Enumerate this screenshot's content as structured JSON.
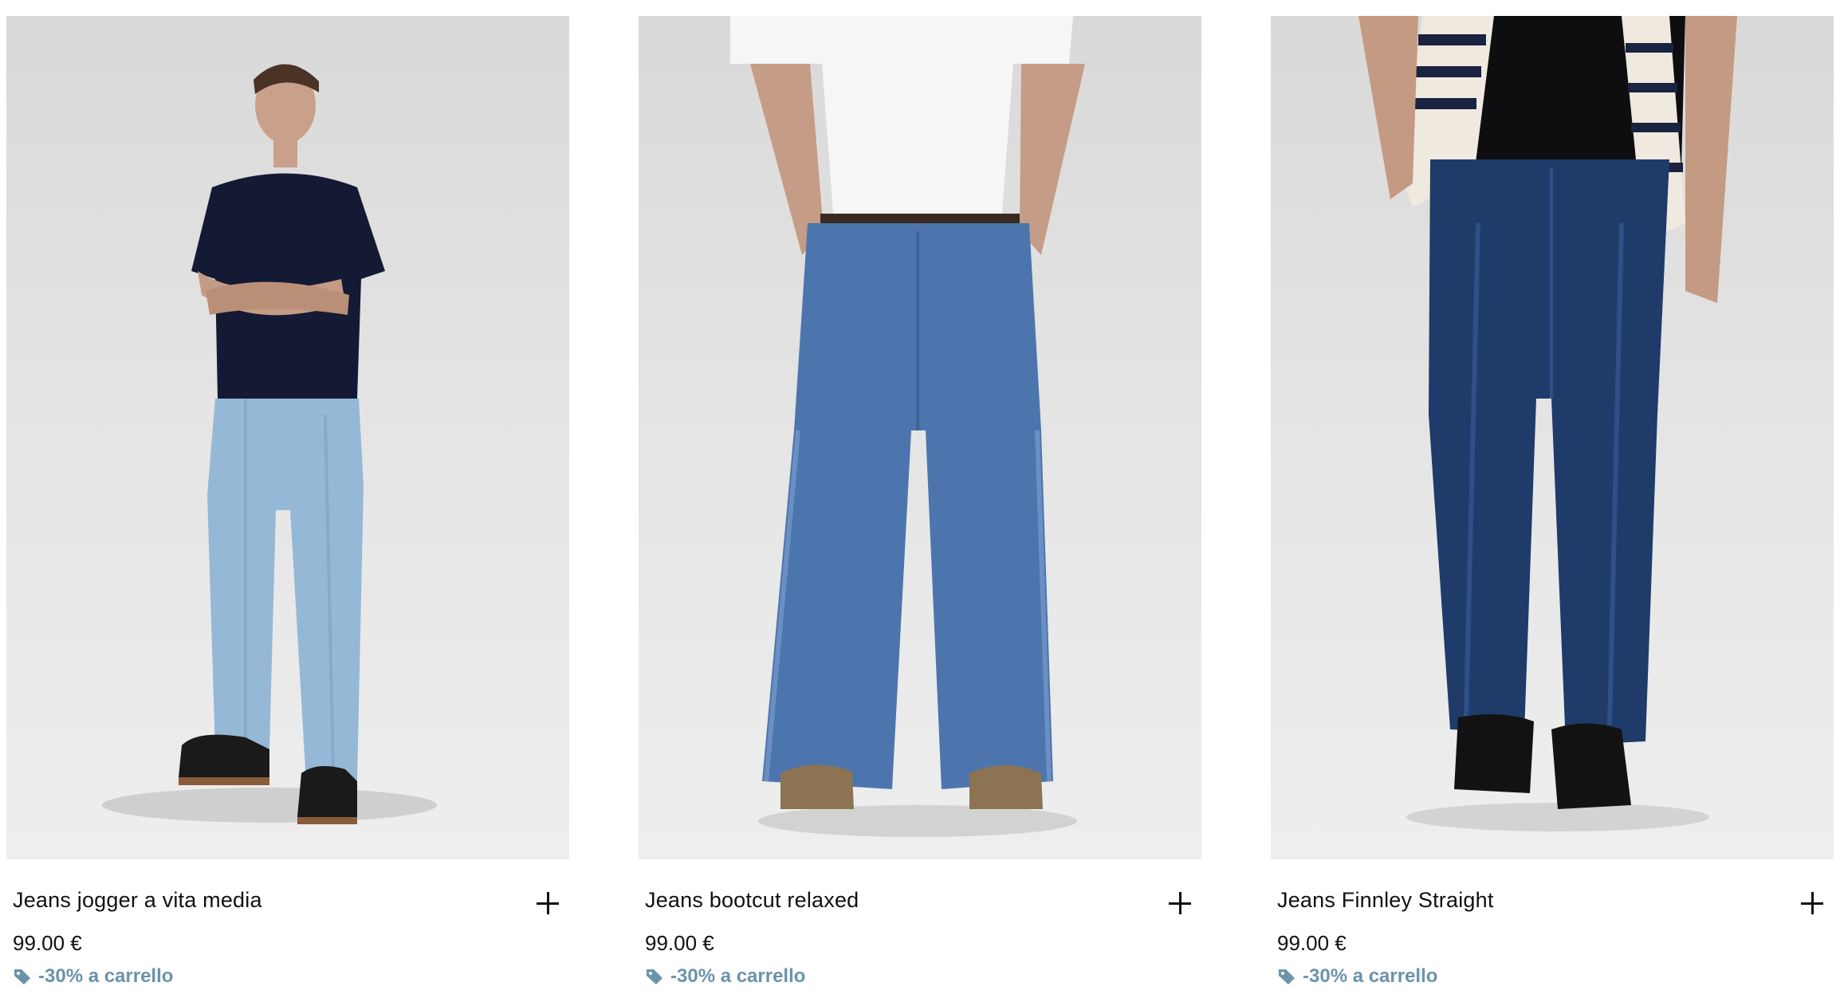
{
  "products": [
    {
      "name": "Jeans jogger a vita media",
      "price": "99.00 €",
      "promo": "-30% a carrello",
      "photo_alt": "jeans-jogger-photo"
    },
    {
      "name": "Jeans bootcut relaxed",
      "price": "99.00 €",
      "promo": "-30% a carrello",
      "photo_alt": "jeans-bootcut-photo"
    },
    {
      "name": "Jeans Finnley Straight",
      "price": "99.00 €",
      "promo": "-30% a carrello",
      "photo_alt": "jeans-finnley-photo"
    }
  ],
  "icons": {
    "add": "plus-icon",
    "promo": "tag-icon"
  },
  "colors": {
    "promo": "#6b93ab",
    "text": "#111111",
    "photo_bg": "#e3e3e3"
  }
}
